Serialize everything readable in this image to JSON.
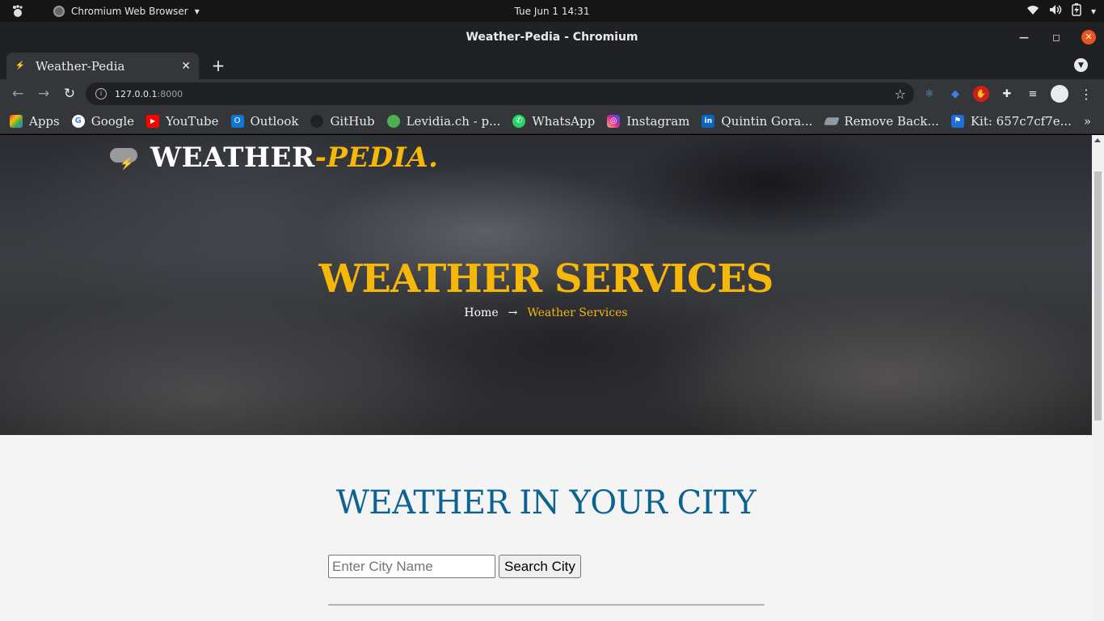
{
  "os_bar": {
    "app_name": "Chromium Web Browser",
    "clock": "Tue Jun 1  14:31"
  },
  "window": {
    "title": "Weather-Pedia - Chromium"
  },
  "tabs": [
    {
      "label": "Weather-Pedia",
      "active": true
    }
  ],
  "toolbar": {
    "url_host": "127.0.0.1",
    "url_port": ":8000"
  },
  "bookmarks": [
    {
      "label": "Apps",
      "icon": "apps-grid-icon",
      "color": "#e94235"
    },
    {
      "label": "Google",
      "icon": "google-icon",
      "color": "#ffffff"
    },
    {
      "label": "YouTube",
      "icon": "youtube-icon",
      "color": "#ff0000"
    },
    {
      "label": "Outlook",
      "icon": "outlook-icon",
      "color": "#0f78d4"
    },
    {
      "label": "GitHub",
      "icon": "github-icon",
      "color": "#202124"
    },
    {
      "label": "Levidia.ch - p...",
      "icon": "levidia-icon",
      "color": "#4caf50"
    },
    {
      "label": "WhatsApp",
      "icon": "whatsapp-icon",
      "color": "#25d366"
    },
    {
      "label": "Instagram",
      "icon": "instagram-icon",
      "color": "#d6249f"
    },
    {
      "label": "Quintin Gora...",
      "icon": "linkedin-icon",
      "color": "#0a66c2"
    },
    {
      "label": "Remove Back...",
      "icon": "remove-bg-icon",
      "color": "#8e9aa6"
    },
    {
      "label": "Kit: 657c7cf7e...",
      "icon": "flag-icon",
      "color": "#1e6fd9"
    }
  ],
  "page": {
    "logo_main": "WEATHER",
    "logo_accent": "-PEDIA.",
    "hero_title": "WEATHER SERVICES",
    "breadcrumb_home": "Home",
    "breadcrumb_arrow": "→",
    "breadcrumb_current": "Weather Services",
    "section_title": "WEATHER IN YOUR CITY",
    "search_placeholder": "Enter City Name",
    "search_button": "Search City"
  },
  "colors": {
    "accent": "#f5b70a",
    "section_title": "#0c6392"
  }
}
